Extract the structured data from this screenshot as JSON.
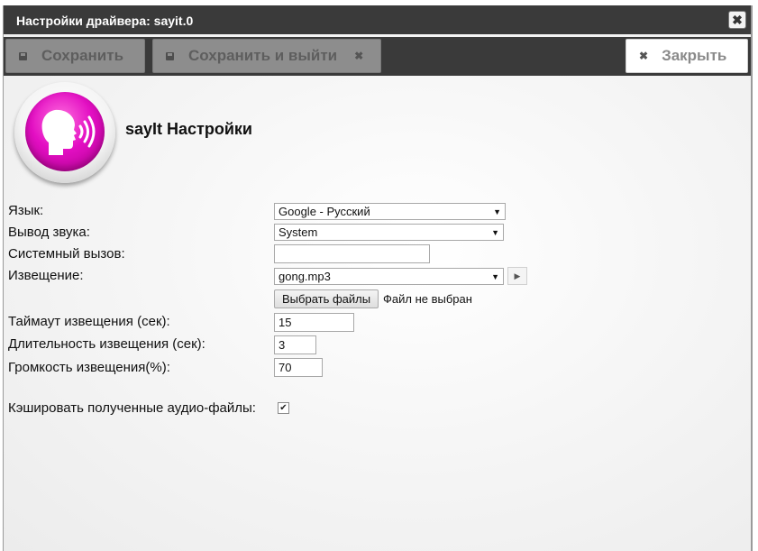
{
  "window": {
    "title": "Настройки драйвера: sayit.0"
  },
  "toolbar": {
    "save_label": "Сохранить",
    "save_exit_label": "Сохранить и выйти",
    "close_label": "Закрыть"
  },
  "header": {
    "title": "sayIt Настройки"
  },
  "form": {
    "language": {
      "label": "Язык:",
      "value": "Google - Русский"
    },
    "sound_output": {
      "label": "Вывод звука:",
      "value": "System"
    },
    "system_call": {
      "label": "Системный вызов:",
      "value": ""
    },
    "announce": {
      "label": "Извещение:",
      "value": "gong.mp3",
      "choose_files_label": "Выбрать файлы",
      "file_status": "Файл не выбран"
    },
    "announce_timeout": {
      "label": "Таймаут извещения (сек):",
      "value": "15"
    },
    "announce_duration": {
      "label": "Длительность извещения (сек):",
      "value": "3"
    },
    "announce_volume": {
      "label": "Громкость извещения(%):",
      "value": "70"
    },
    "cache_files": {
      "label": "Кэшировать полученные аудио-файлы:",
      "checked": true
    }
  },
  "icons": {
    "logo": "speaking-head-icon",
    "save": "floppy-icon",
    "close": "close-icon",
    "play": "play-icon",
    "dropdown": "chevron-down-icon"
  },
  "colors": {
    "titlebar": "#3a3a3a",
    "logo_accent": "#e30fc3"
  }
}
